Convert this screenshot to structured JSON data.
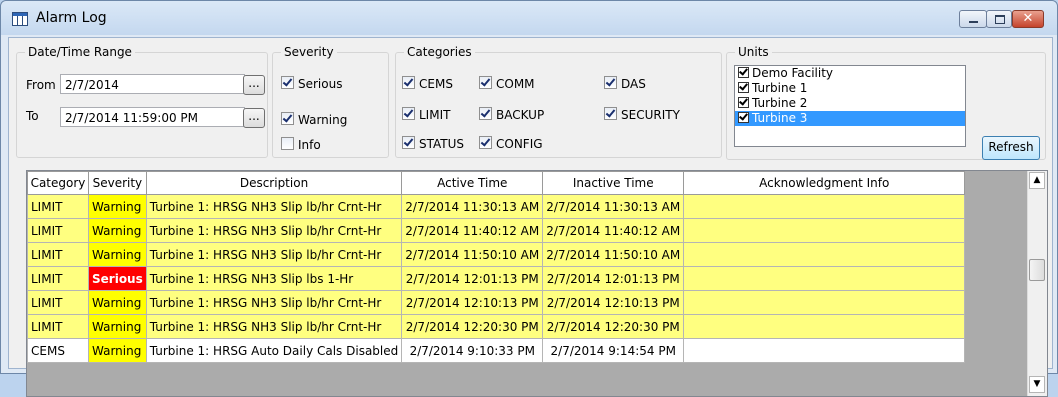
{
  "window": {
    "title": "Alarm Log",
    "close_glyph": "✕"
  },
  "date_range": {
    "group_label": "Date/Time Range",
    "from_label": "From",
    "from_value": "2/7/2014",
    "to_label": "To",
    "to_value": "2/7/2014 11:59:00 PM",
    "browse_label": "..."
  },
  "severity": {
    "group_label": "Severity",
    "items": [
      {
        "label": "Serious",
        "checked": true
      },
      {
        "label": "Warning",
        "checked": true
      },
      {
        "label": "Info",
        "checked": false
      }
    ]
  },
  "categories": {
    "group_label": "Categories",
    "items": [
      {
        "label": "CEMS",
        "checked": true
      },
      {
        "label": "COMM",
        "checked": true
      },
      {
        "label": "DAS",
        "checked": true
      },
      {
        "label": "LIMIT",
        "checked": true
      },
      {
        "label": "BACKUP",
        "checked": true
      },
      {
        "label": "SECURITY",
        "checked": true
      },
      {
        "label": "STATUS",
        "checked": true
      },
      {
        "label": "CONFIG",
        "checked": true
      }
    ]
  },
  "units": {
    "group_label": "Units",
    "items": [
      {
        "label": "Demo Facility",
        "checked": true,
        "selected": false
      },
      {
        "label": "Turbine 1",
        "checked": true,
        "selected": false
      },
      {
        "label": "Turbine 2",
        "checked": true,
        "selected": false
      },
      {
        "label": "Turbine 3",
        "checked": true,
        "selected": true
      }
    ]
  },
  "refresh_label": "Refresh",
  "table": {
    "columns": [
      "Category",
      "Severity",
      "Description",
      "Active Time",
      "Inactive Time",
      "Acknowledgment Info"
    ],
    "rows": [
      {
        "category": "LIMIT",
        "severity": "Warning",
        "description": "Turbine 1: HRSG NH3 Slip lb/hr Crnt-Hr",
        "active": "2/7/2014 11:30:13 AM",
        "inactive": "2/7/2014 11:30:13 AM",
        "ack": ""
      },
      {
        "category": "LIMIT",
        "severity": "Warning",
        "description": "Turbine 1: HRSG NH3 Slip lb/hr Crnt-Hr",
        "active": "2/7/2014 11:40:12 AM",
        "inactive": "2/7/2014 11:40:12 AM",
        "ack": ""
      },
      {
        "category": "LIMIT",
        "severity": "Warning",
        "description": "Turbine 1: HRSG NH3 Slip lb/hr Crnt-Hr",
        "active": "2/7/2014 11:50:10 AM",
        "inactive": "2/7/2014 11:50:10 AM",
        "ack": ""
      },
      {
        "category": "LIMIT",
        "severity": "Serious",
        "description": "Turbine 1: HRSG NH3 Slip lbs 1-Hr",
        "active": "2/7/2014 12:01:13 PM",
        "inactive": "2/7/2014 12:01:13 PM",
        "ack": ""
      },
      {
        "category": "LIMIT",
        "severity": "Warning",
        "description": "Turbine 1: HRSG NH3 Slip lb/hr Crnt-Hr",
        "active": "2/7/2014 12:10:13 PM",
        "inactive": "2/7/2014 12:10:13 PM",
        "ack": ""
      },
      {
        "category": "LIMIT",
        "severity": "Warning",
        "description": "Turbine 1: HRSG NH3 Slip lb/hr Crnt-Hr",
        "active": "2/7/2014 12:20:30 PM",
        "inactive": "2/7/2014 12:20:30 PM",
        "ack": ""
      },
      {
        "category": "CEMS",
        "severity": "Warning",
        "description": "Turbine 1: HRSG Auto Daily Cals Disabled",
        "active": "2/7/2014 9:10:33 PM",
        "inactive": "2/7/2014 9:14:54 PM",
        "ack": ""
      }
    ]
  },
  "colors": {
    "row_highlight": "#ffff80",
    "warning": "#ffff00",
    "serious": "#ff0000",
    "selection": "#3399ff"
  },
  "icons": {
    "scroll_up": "▲",
    "scroll_down": "▼"
  }
}
